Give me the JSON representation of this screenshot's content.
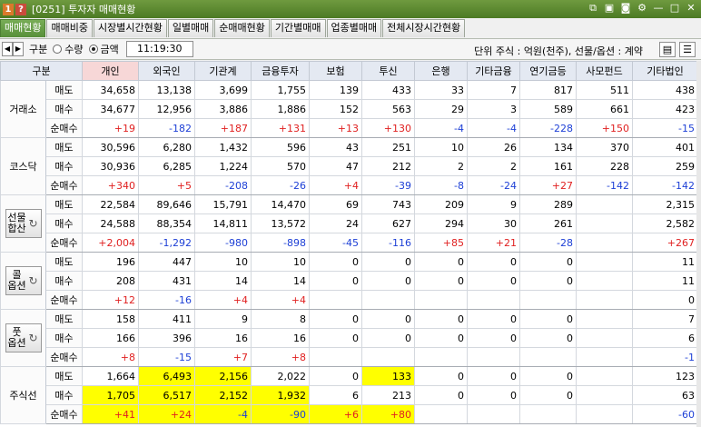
{
  "window": {
    "title": "[0251] 투자자 매매현황",
    "badge1": "1",
    "badge2": "?"
  },
  "title_icons": [
    "link-icon",
    "copy-icon",
    "camera-icon",
    "gear-icon",
    "minimize-icon",
    "maximize-icon",
    "close-icon"
  ],
  "title_icon_glyphs": [
    "⧉",
    "▣",
    "◙",
    "⚙",
    "—",
    "□",
    "✕"
  ],
  "tabs": [
    "매매현황",
    "매매비중",
    "시장별시간현황",
    "일별매매",
    "순매매현황",
    "기간별매매",
    "업종별매매",
    "전체시장시간현황"
  ],
  "toolbar": {
    "label": "구분",
    "radio1": "수량",
    "radio2": "금액",
    "time": "11:19:30",
    "unit": "단위 주식 : 억원(천주), 선물/옵션 : 계약"
  },
  "columns": [
    "구분",
    "개인",
    "외국인",
    "기관계",
    "금융투자",
    "보험",
    "투신",
    "은행",
    "기타금융",
    "연기금등",
    "사모펀드",
    "기타법인"
  ],
  "row_labels": [
    "매도",
    "매수",
    "순매수"
  ],
  "groups": [
    {
      "name": "거래소",
      "button": false,
      "sell": [
        "34,658",
        "13,138",
        "3,699",
        "1,755",
        "139",
        "433",
        "33",
        "7",
        "817",
        "511",
        "438"
      ],
      "buy": [
        "34,677",
        "12,956",
        "3,886",
        "1,886",
        "152",
        "563",
        "29",
        "3",
        "589",
        "661",
        "423"
      ],
      "net": [
        "+19",
        "-182",
        "+187",
        "+131",
        "+13",
        "+130",
        "-4",
        "-4",
        "-228",
        "+150",
        "-15"
      ]
    },
    {
      "name": "코스닥",
      "button": false,
      "sell": [
        "30,596",
        "6,280",
        "1,432",
        "596",
        "43",
        "251",
        "10",
        "26",
        "134",
        "370",
        "401"
      ],
      "buy": [
        "30,936",
        "6,285",
        "1,224",
        "570",
        "47",
        "212",
        "2",
        "2",
        "161",
        "228",
        "259"
      ],
      "net": [
        "+340",
        "+5",
        "-208",
        "-26",
        "+4",
        "-39",
        "-8",
        "-24",
        "+27",
        "-142",
        "-142"
      ]
    },
    {
      "name1": "선물",
      "name2": "합산",
      "button": true,
      "sell": [
        "22,584",
        "89,646",
        "15,791",
        "14,470",
        "69",
        "743",
        "209",
        "9",
        "289",
        "",
        "2,315"
      ],
      "buy": [
        "24,588",
        "88,354",
        "14,811",
        "13,572",
        "24",
        "627",
        "294",
        "30",
        "261",
        "",
        "2,582"
      ],
      "net": [
        "+2,004",
        "-1,292",
        "-980",
        "-898",
        "-45",
        "-116",
        "+85",
        "+21",
        "-28",
        "",
        "+267"
      ]
    },
    {
      "name1": "콜",
      "name2": "옵션",
      "button": true,
      "sell": [
        "196",
        "447",
        "10",
        "10",
        "0",
        "0",
        "0",
        "0",
        "0",
        "",
        "11"
      ],
      "buy": [
        "208",
        "431",
        "14",
        "14",
        "0",
        "0",
        "0",
        "0",
        "0",
        "",
        "11"
      ],
      "net": [
        "+12",
        "-16",
        "+4",
        "+4",
        "",
        "",
        "",
        "",
        "",
        "",
        "0"
      ]
    },
    {
      "name1": "풋",
      "name2": "옵션",
      "button": true,
      "sell": [
        "158",
        "411",
        "9",
        "8",
        "0",
        "0",
        "0",
        "0",
        "0",
        "",
        "7"
      ],
      "buy": [
        "166",
        "396",
        "16",
        "16",
        "0",
        "0",
        "0",
        "0",
        "0",
        "",
        "6"
      ],
      "net": [
        "+8",
        "-15",
        "+7",
        "+8",
        "",
        "",
        "",
        "",
        "",
        "",
        "-1"
      ]
    },
    {
      "name": "주식선",
      "button": false,
      "sell": [
        "1,664",
        "6,493",
        "2,156",
        "2,022",
        "0",
        "133",
        "0",
        "0",
        "0",
        "",
        "123"
      ],
      "buy": [
        "1,705",
        "6,517",
        "2,152",
        "1,932",
        "6",
        "213",
        "0",
        "0",
        "0",
        "",
        "63"
      ],
      "net": [
        "+41",
        "+24",
        "-4",
        "-90",
        "+6",
        "+80",
        "",
        "",
        "",
        "",
        "-60"
      ],
      "highlight": {
        "sell": [
          1,
          2,
          5
        ],
        "buy": [
          0,
          1,
          2,
          3
        ],
        "net": [
          0,
          1,
          2,
          3,
          4,
          5
        ]
      }
    }
  ],
  "colors": {
    "positive": "#e02020",
    "negative": "#1d3fd6",
    "highlight": "#ffff00",
    "tab_active": "#58903a",
    "titlebar": "#4c7a24"
  }
}
